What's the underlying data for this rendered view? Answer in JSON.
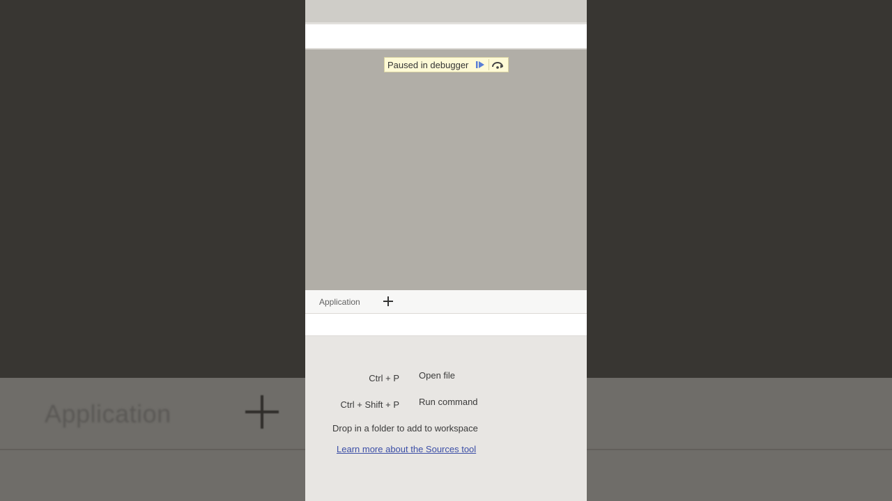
{
  "debugger": {
    "paused_label": "Paused in debugger",
    "resume_icon": "resume-icon",
    "step_over_icon": "step-over-icon"
  },
  "drawer": {
    "tab_label": "Application",
    "add_icon": "plus-icon"
  },
  "sources_empty": {
    "shortcuts": [
      {
        "keys": "Ctrl + P",
        "action": "Open file"
      },
      {
        "keys": "Ctrl + Shift + P",
        "action": "Run command"
      }
    ],
    "drop_hint": "Drop in a folder to add to workspace",
    "learn_link": "Learn more about the Sources tool"
  },
  "backdrop": {
    "tab_label": "Application"
  },
  "colors": {
    "paused_bg": "#fefad6",
    "link": "#3b4ea6",
    "viewport_bg": "#b1aea7"
  }
}
